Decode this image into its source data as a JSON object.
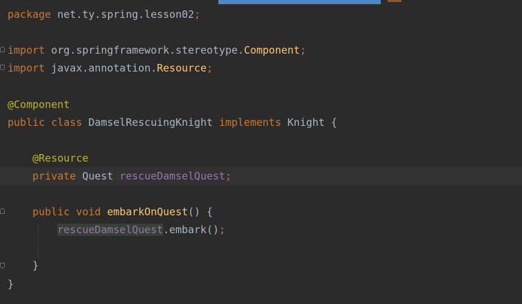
{
  "editor": {
    "lines": [
      {
        "tokens": [
          {
            "t": "package ",
            "c": "kw"
          },
          {
            "t": "net.ty.spring.lesson02",
            "c": ""
          },
          {
            "t": ";",
            "c": "kw"
          }
        ]
      },
      {
        "tokens": []
      },
      {
        "tokens": [
          {
            "t": "import ",
            "c": "kw"
          },
          {
            "t": "org.springframework.stereotype.",
            "c": ""
          },
          {
            "t": "Component",
            "c": "fn"
          },
          {
            "t": ";",
            "c": "kw"
          }
        ]
      },
      {
        "tokens": [
          {
            "t": "import ",
            "c": "kw"
          },
          {
            "t": "javax.annotation.",
            "c": ""
          },
          {
            "t": "Resource",
            "c": "fn"
          },
          {
            "t": ";",
            "c": "kw"
          }
        ]
      },
      {
        "tokens": []
      },
      {
        "tokens": [
          {
            "t": "@Component",
            "c": "ann"
          }
        ]
      },
      {
        "tokens": [
          {
            "t": "public class ",
            "c": "kw"
          },
          {
            "t": "DamselRescuingKnight ",
            "c": ""
          },
          {
            "t": "implements ",
            "c": "kw"
          },
          {
            "t": "Knight {",
            "c": ""
          }
        ]
      },
      {
        "tokens": []
      },
      {
        "tokens": [
          {
            "t": "    ",
            "c": ""
          },
          {
            "t": "@Resource",
            "c": "ann"
          }
        ]
      },
      {
        "tokens": [
          {
            "t": "    ",
            "c": ""
          },
          {
            "t": "private ",
            "c": "kw"
          },
          {
            "t": "Quest ",
            "c": ""
          },
          {
            "t": "rescueDamselQuest",
            "c": "fld"
          },
          {
            "t": ";",
            "c": "kw"
          }
        ],
        "caret": true
      },
      {
        "tokens": []
      },
      {
        "tokens": [
          {
            "t": "    ",
            "c": ""
          },
          {
            "t": "public void ",
            "c": "kw"
          },
          {
            "t": "embarkOnQuest",
            "c": "fn"
          },
          {
            "t": "() {",
            "c": ""
          }
        ]
      },
      {
        "tokens": [
          {
            "t": "        ",
            "c": ""
          },
          {
            "t": "rescueDamselQuest",
            "c": "fld-hl"
          },
          {
            "t": ".embark()",
            "c": ""
          },
          {
            "t": ";",
            "c": "kw"
          }
        ]
      },
      {
        "tokens": []
      },
      {
        "tokens": [
          {
            "t": "    }",
            "c": ""
          }
        ]
      },
      {
        "tokens": [
          {
            "t": "}",
            "c": ""
          }
        ]
      }
    ]
  }
}
